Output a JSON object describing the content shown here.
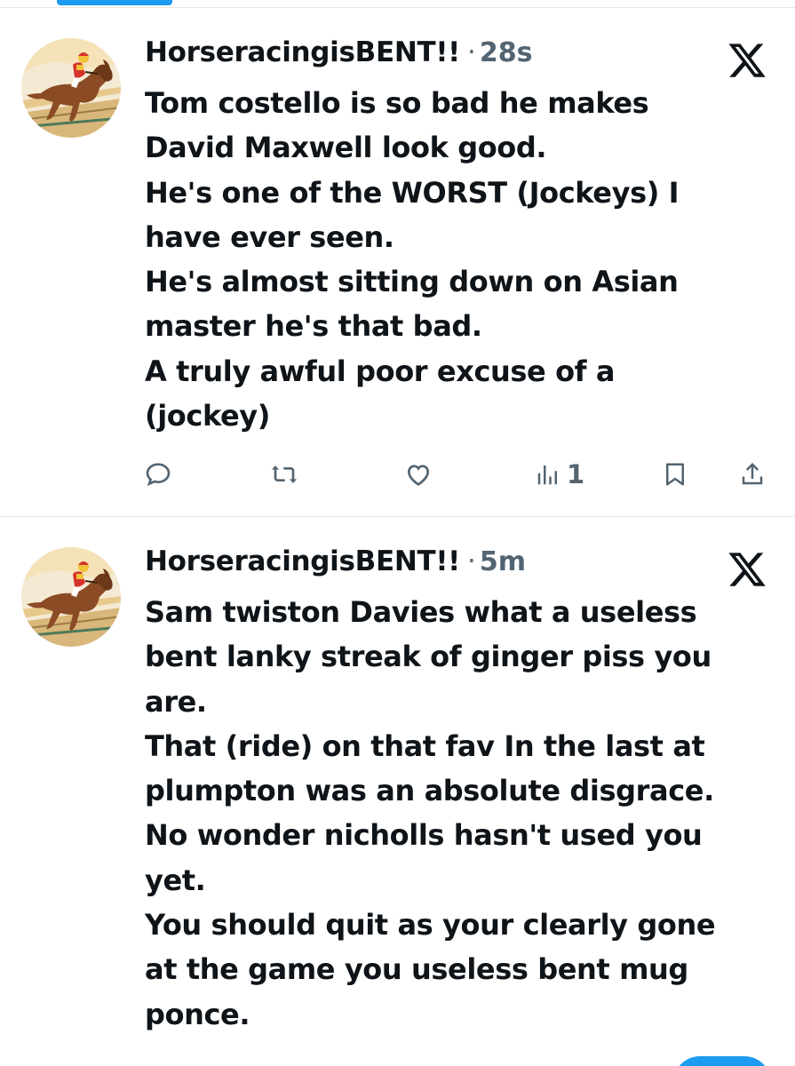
{
  "posts": [
    {
      "display_name": "HorseracingisBENT!!",
      "separator": "·",
      "timestamp": "28s",
      "body_lines": [
        "Tom costello is so bad he makes",
        "David Maxwell look good.",
        "He's one of the WORST (Jockeys) I",
        "have ever seen.",
        "He's almost sitting down on Asian",
        "master he's that bad.",
        "A truly awful poor excuse of a",
        "(jockey)"
      ],
      "views": "1"
    },
    {
      "display_name": "HorseracingisBENT!!",
      "separator": "·",
      "timestamp": "5m",
      "body_lines": [
        "Sam twiston Davies what a useless",
        "bent lanky streak of ginger piss you",
        "are.",
        "That (ride) on that fav In the last at",
        "plumpton was an absolute disgrace.",
        "No wonder nicholls hasn't used you",
        "yet.",
        "You should quit as your clearly gone",
        "at the game you useless bent mug",
        "ponce."
      ]
    }
  ],
  "icons": {
    "avatar": "racehorse-jockey-avatar",
    "brand": "x-logo-icon",
    "reply": "reply-icon",
    "repost": "repost-icon",
    "like": "like-icon",
    "views": "views-icon",
    "bookmark": "bookmark-icon",
    "share": "share-icon"
  },
  "colors": {
    "text": "#0f1419",
    "secondary": "#536471",
    "accent": "#1d9bf0",
    "divider": "#e6e9ea"
  }
}
